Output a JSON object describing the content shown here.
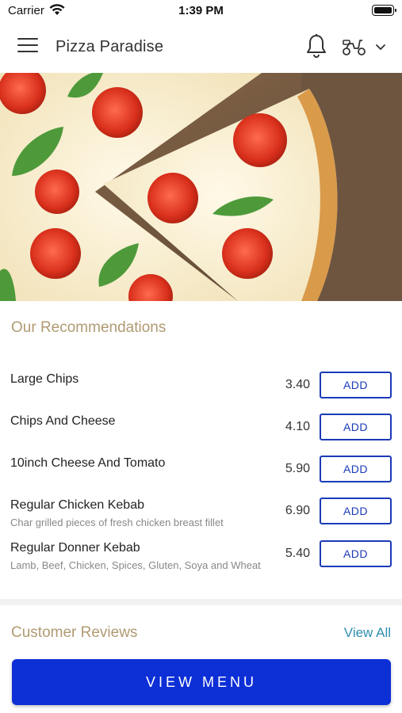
{
  "status_bar": {
    "carrier": "Carrier",
    "time": "1:39 PM"
  },
  "header": {
    "title": "Pizza Paradise",
    "icons": [
      "menu-icon",
      "bell-icon",
      "scooter-icon",
      "chevron-down-icon"
    ]
  },
  "hero": {
    "image": "pizza-photo"
  },
  "recommendations": {
    "title": "Our Recommendations",
    "add_label": "ADD",
    "items": [
      {
        "name": "Large Chips",
        "description": "",
        "price": "3.40"
      },
      {
        "name": "Chips And Cheese",
        "description": "",
        "price": "4.10"
      },
      {
        "name": "10inch Cheese And Tomato",
        "description": "",
        "price": "5.90"
      },
      {
        "name": "Regular Chicken Kebab",
        "description": "Char grilled pieces of fresh chicken breast fillet",
        "price": "6.90"
      },
      {
        "name": "Regular Donner Kebab",
        "description": "Lamb, Beef, Chicken, Spices, Gluten, Soya and Wheat",
        "price": "5.40"
      }
    ]
  },
  "reviews": {
    "title": "Customer Reviews",
    "view_all": "View All"
  },
  "footer": {
    "view_menu": "VIEW MENU"
  },
  "colors": {
    "accent_blue": "#0d2fd6",
    "add_border": "#1b3ab8",
    "section_title": "#b09a72",
    "link": "#2f8fb0"
  }
}
